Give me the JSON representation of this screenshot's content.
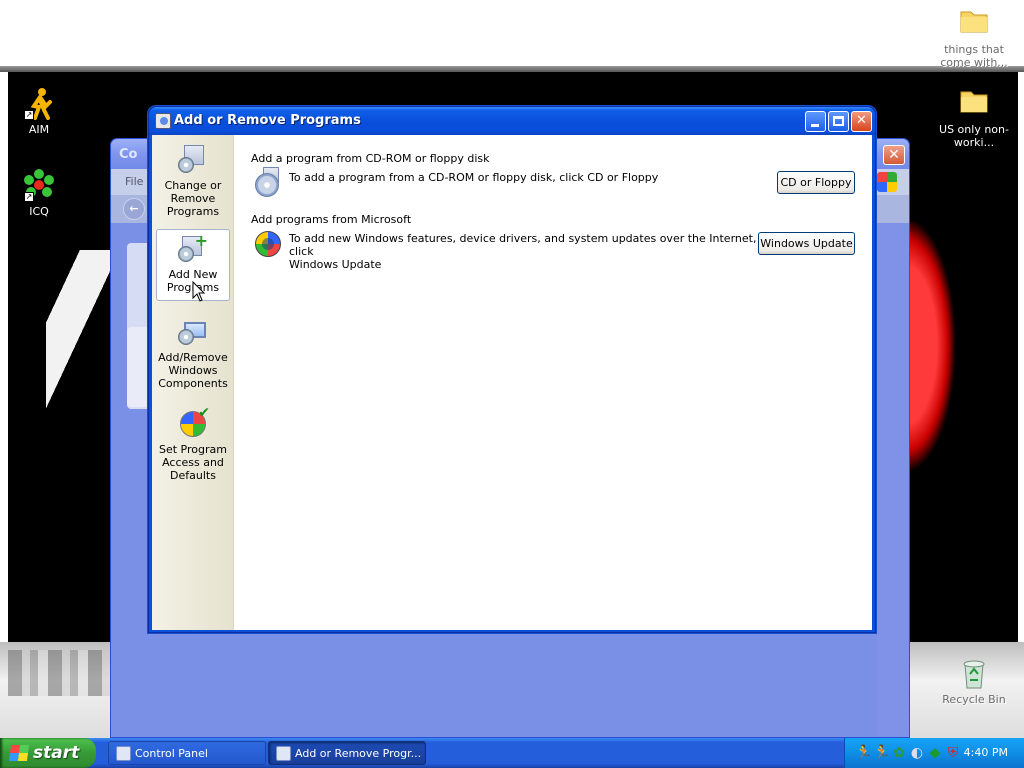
{
  "desktop": {
    "icons": [
      {
        "label": "AIM"
      },
      {
        "label": "ICQ"
      },
      {
        "label": "things that come with..."
      },
      {
        "label": "US only non-worki..."
      },
      {
        "label": "Recycle Bin"
      }
    ]
  },
  "bg_window": {
    "title_partial": "Co",
    "menu_partial": "File"
  },
  "window": {
    "title": "Add or Remove Programs",
    "sidebar": [
      {
        "label": "Change or Remove Programs",
        "icon": "change-remove-programs-icon"
      },
      {
        "label": "Add New Programs",
        "icon": "add-new-programs-icon",
        "active": true
      },
      {
        "label": "Add/Remove Windows Components",
        "icon": "windows-components-icon"
      },
      {
        "label": "Set Program Access and Defaults",
        "icon": "program-access-defaults-icon"
      }
    ],
    "sections": [
      {
        "title": "Add a program from CD-ROM or floppy disk",
        "description": "To add a program from a CD-ROM or floppy disk, click CD or Floppy",
        "button": "CD or Floppy"
      },
      {
        "title": "Add programs from Microsoft",
        "description_line1": "To add new Windows features, device drivers, and system updates over the Internet, click",
        "description_line2": "Windows Update",
        "button": "Windows Update"
      }
    ]
  },
  "taskbar": {
    "start_label": "start",
    "tasks": [
      {
        "label": "Control Panel"
      },
      {
        "label": "Add or Remove Progr..."
      }
    ],
    "clock": "4:40 PM"
  },
  "colors": {
    "titlebar": "#0a4fdc",
    "taskbar": "#245edb",
    "start": "#379a37",
    "sidebar": "#e6e2cf"
  }
}
